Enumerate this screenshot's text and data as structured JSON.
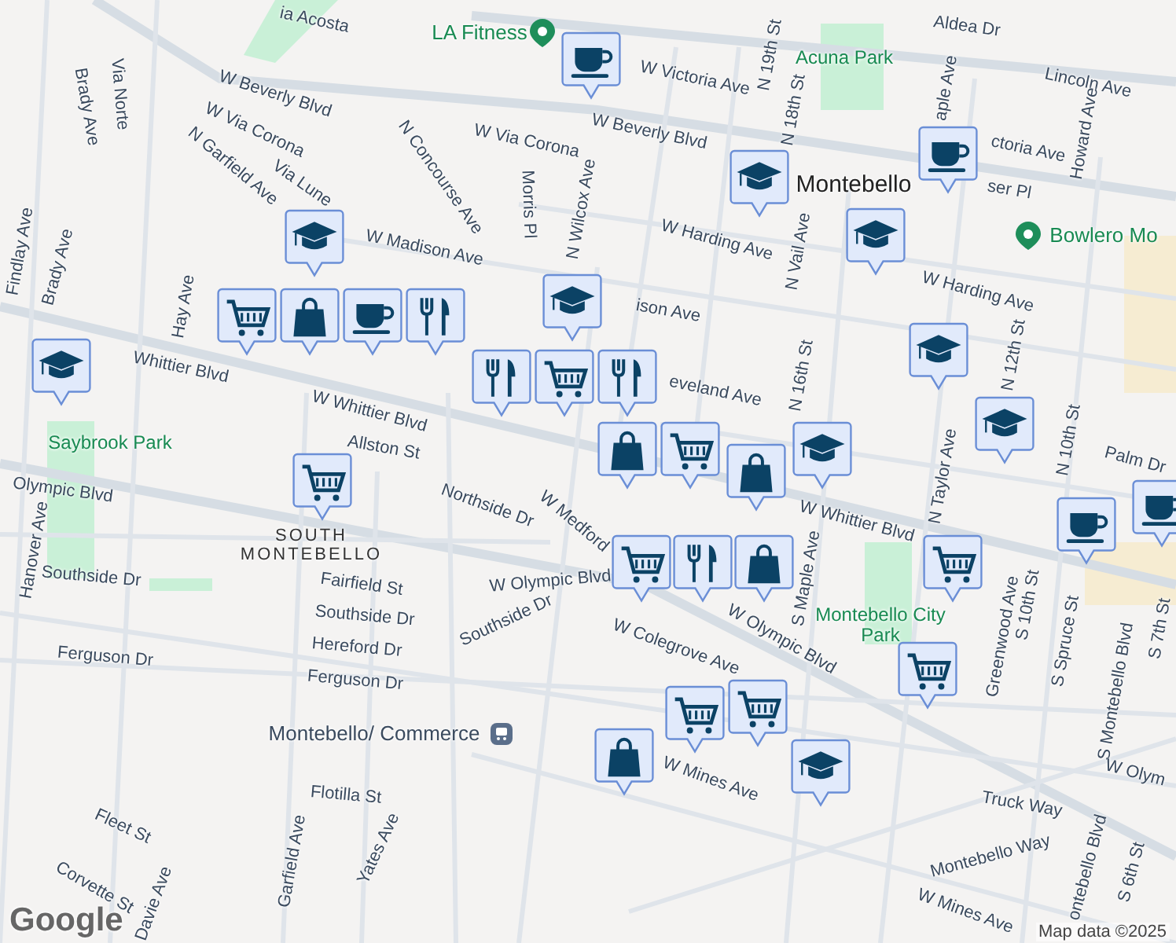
{
  "map": {
    "labels": [
      {
        "text": "ia Acosta",
        "kind": "street"
      },
      {
        "text": "LA Fitness",
        "kind": "poi"
      },
      {
        "text": "W Victoria Ave",
        "kind": "street"
      },
      {
        "text": "Aldea Dr",
        "kind": "street"
      },
      {
        "text": "Acuna Park",
        "kind": "park"
      },
      {
        "text": "Lincoln Ave",
        "kind": "street"
      },
      {
        "text": "Howard Ave",
        "kind": "street"
      },
      {
        "text": "W Beverly Blvd",
        "kind": "street"
      },
      {
        "text": "W Beverly Blvd",
        "kind": "street"
      },
      {
        "text": "N 19th St",
        "kind": "street"
      },
      {
        "text": "N 18th St",
        "kind": "street"
      },
      {
        "text": "ctoria Ave",
        "kind": "street"
      },
      {
        "text": "ser Pl",
        "kind": "street"
      },
      {
        "text": "aple Ave",
        "kind": "street"
      },
      {
        "text": "Montebello",
        "kind": "city"
      },
      {
        "text": "Bowlero Mo",
        "kind": "poi"
      },
      {
        "text": "Via Norte",
        "kind": "street"
      },
      {
        "text": "Brady Ave",
        "kind": "street"
      },
      {
        "text": "Brady Ave",
        "kind": "street"
      },
      {
        "text": "Findlay Ave",
        "kind": "street"
      },
      {
        "text": "W Via Corona",
        "kind": "street"
      },
      {
        "text": "W Via Corona",
        "kind": "street"
      },
      {
        "text": "N Garfield Ave",
        "kind": "street"
      },
      {
        "text": "Via Lune",
        "kind": "street"
      },
      {
        "text": "N Concourse Ave",
        "kind": "street"
      },
      {
        "text": "Morris Pl",
        "kind": "street"
      },
      {
        "text": "N Wilcox Ave",
        "kind": "street"
      },
      {
        "text": "W Madison Ave",
        "kind": "street"
      },
      {
        "text": "Hay Ave",
        "kind": "street"
      },
      {
        "text": "Whittier Blvd",
        "kind": "street"
      },
      {
        "text": "W Whittier Blvd",
        "kind": "street"
      },
      {
        "text": "Allston St",
        "kind": "street"
      },
      {
        "text": "Saybrook Park",
        "kind": "park"
      },
      {
        "text": "ison Ave",
        "kind": "street"
      },
      {
        "text": "W Harding Ave",
        "kind": "street"
      },
      {
        "text": "N Vail Ave",
        "kind": "street"
      },
      {
        "text": "W Harding Ave",
        "kind": "street"
      },
      {
        "text": "eveland Ave",
        "kind": "street"
      },
      {
        "text": "N 16th St",
        "kind": "street"
      },
      {
        "text": "N 12th St",
        "kind": "street"
      },
      {
        "text": "N 10th St",
        "kind": "street"
      },
      {
        "text": "Palm Dr",
        "kind": "street"
      },
      {
        "text": "N Taylor Ave",
        "kind": "street"
      },
      {
        "text": "W Whittier Blvd",
        "kind": "street"
      },
      {
        "text": "Olympic Blvd",
        "kind": "street"
      },
      {
        "text": "Northside Dr",
        "kind": "street"
      },
      {
        "text": "W Medford",
        "kind": "street"
      },
      {
        "text": "S Maple Ave",
        "kind": "street"
      },
      {
        "text": "SOUTH MONTEBELLO",
        "kind": "district"
      },
      {
        "text": "Hanover Ave",
        "kind": "street"
      },
      {
        "text": "Southside Dr",
        "kind": "street"
      },
      {
        "text": "Fairfield St",
        "kind": "street"
      },
      {
        "text": "W Olympic Blvd",
        "kind": "street"
      },
      {
        "text": "Southside Dr",
        "kind": "street"
      },
      {
        "text": "Southside Dr",
        "kind": "street"
      },
      {
        "text": "Hereford Dr",
        "kind": "street"
      },
      {
        "text": "Ferguson Dr",
        "kind": "street"
      },
      {
        "text": "Ferguson Dr",
        "kind": "street"
      },
      {
        "text": "Montebello City Park",
        "kind": "park"
      },
      {
        "text": "W Olympic Blvd",
        "kind": "street"
      },
      {
        "text": "W Colegrove Ave",
        "kind": "street"
      },
      {
        "text": "Greenwood Ave",
        "kind": "street"
      },
      {
        "text": "S 10th St",
        "kind": "street"
      },
      {
        "text": "S Spruce St",
        "kind": "street"
      },
      {
        "text": "S Montebello Blvd",
        "kind": "street"
      },
      {
        "text": "S 7th St",
        "kind": "street"
      },
      {
        "text": "W Olym",
        "kind": "street"
      },
      {
        "text": "Montebello/ Commerce",
        "kind": "transit"
      },
      {
        "text": "Flotilla St",
        "kind": "street"
      },
      {
        "text": "Fleet St",
        "kind": "street"
      },
      {
        "text": "Corvette St",
        "kind": "street"
      },
      {
        "text": "Davie Ave",
        "kind": "street"
      },
      {
        "text": "Garfield Ave",
        "kind": "street"
      },
      {
        "text": "Yates Ave",
        "kind": "street"
      },
      {
        "text": "W Mines Ave",
        "kind": "street"
      },
      {
        "text": "Truck Way",
        "kind": "street"
      },
      {
        "text": "Montebello Way",
        "kind": "street"
      },
      {
        "text": "W Mines Ave",
        "kind": "street"
      },
      {
        "text": "ontebello Blvd",
        "kind": "street"
      },
      {
        "text": "S 6th St",
        "kind": "street"
      }
    ],
    "markers": [
      {
        "kind": "cafe"
      },
      {
        "kind": "school"
      },
      {
        "kind": "cart"
      },
      {
        "kind": "school"
      },
      {
        "kind": "bag"
      },
      {
        "kind": "cafe"
      },
      {
        "kind": "food"
      },
      {
        "kind": "food"
      },
      {
        "kind": "cart"
      },
      {
        "kind": "food"
      },
      {
        "kind": "school"
      },
      {
        "kind": "bag"
      },
      {
        "kind": "cart"
      },
      {
        "kind": "school"
      },
      {
        "kind": "school"
      },
      {
        "kind": "school"
      },
      {
        "kind": "cafe"
      },
      {
        "kind": "school"
      },
      {
        "kind": "school"
      },
      {
        "kind": "bag"
      },
      {
        "kind": "cafe"
      },
      {
        "kind": "cafe"
      },
      {
        "kind": "cart"
      },
      {
        "kind": "cart"
      },
      {
        "kind": "food"
      },
      {
        "kind": "bag"
      },
      {
        "kind": "cart"
      },
      {
        "kind": "cart"
      },
      {
        "kind": "cart"
      },
      {
        "kind": "cart"
      },
      {
        "kind": "bag"
      },
      {
        "kind": "school"
      }
    ],
    "logo": "Google",
    "attribution": "Map data ©2025"
  }
}
